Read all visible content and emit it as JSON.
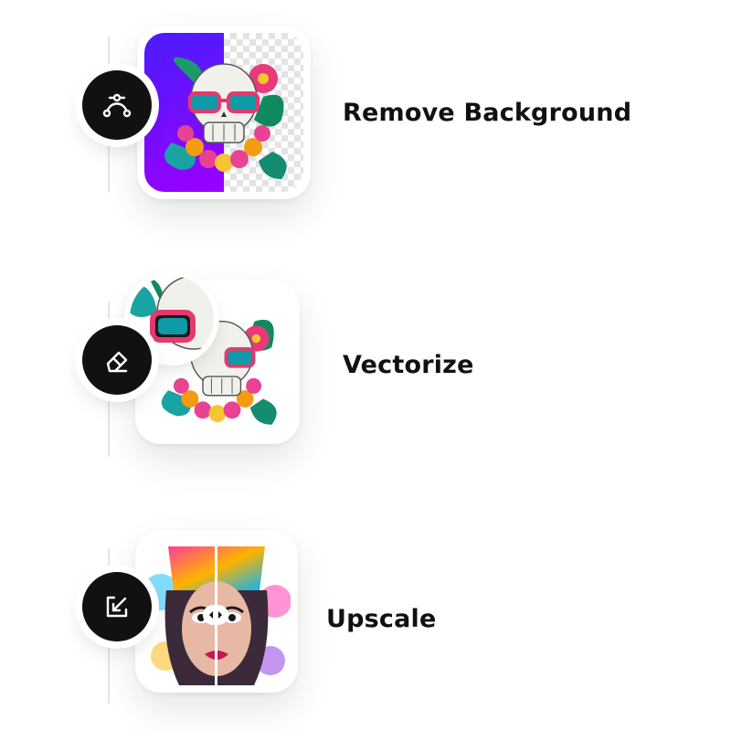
{
  "features": [
    {
      "label": "Remove Background",
      "icon": "bezier-path-icon"
    },
    {
      "label": "Vectorize",
      "icon": "eraser-icon"
    },
    {
      "label": "Upscale",
      "icon": "resize-arrow-icon"
    }
  ],
  "colors": {
    "badge": "#111111",
    "label": "#111111",
    "purple_gradient_start": "#4a1cff",
    "purple_gradient_end": "#9b00ff",
    "line": "#e6e6e6"
  }
}
